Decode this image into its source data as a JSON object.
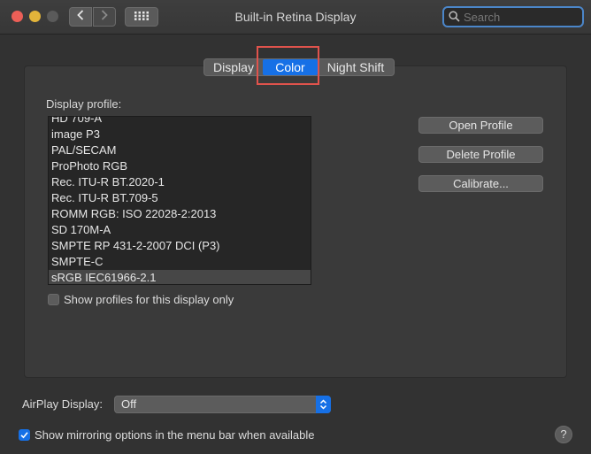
{
  "window": {
    "title": "Built-in Retina Display",
    "search_placeholder": "Search"
  },
  "toolbar": {
    "back_icon": "chevron-left-icon",
    "forward_icon": "chevron-right-icon",
    "grid_icon": "grid-icon"
  },
  "tabs": [
    {
      "label": "Display",
      "selected": false
    },
    {
      "label": "Color",
      "selected": true
    },
    {
      "label": "Night Shift",
      "selected": false
    }
  ],
  "profiles": {
    "label": "Display profile:",
    "items": [
      "HD 709-A",
      "image P3",
      "PAL/SECAM",
      "ProPhoto RGB",
      "Rec. ITU-R BT.2020-1",
      "Rec. ITU-R BT.709-5",
      "ROMM RGB: ISO 22028-2:2013",
      "SD 170M-A",
      "SMPTE RP 431-2-2007 DCI (P3)",
      "SMPTE-C",
      "sRGB IEC61966-2.1"
    ],
    "selected": "sRGB IEC61966-2.1"
  },
  "buttons": {
    "open_profile": "Open Profile",
    "delete_profile": "Delete Profile",
    "calibrate": "Calibrate..."
  },
  "show_profiles_checkbox": {
    "label": "Show profiles for this display only",
    "checked": false
  },
  "airplay": {
    "label": "AirPlay Display:",
    "value": "Off"
  },
  "mirroring_checkbox": {
    "label": "Show mirroring options in the menu bar when available",
    "checked": true
  },
  "help_label": "?",
  "colors": {
    "accent": "#1670e6",
    "highlight_box": "#e0534c",
    "background": "#323232"
  }
}
